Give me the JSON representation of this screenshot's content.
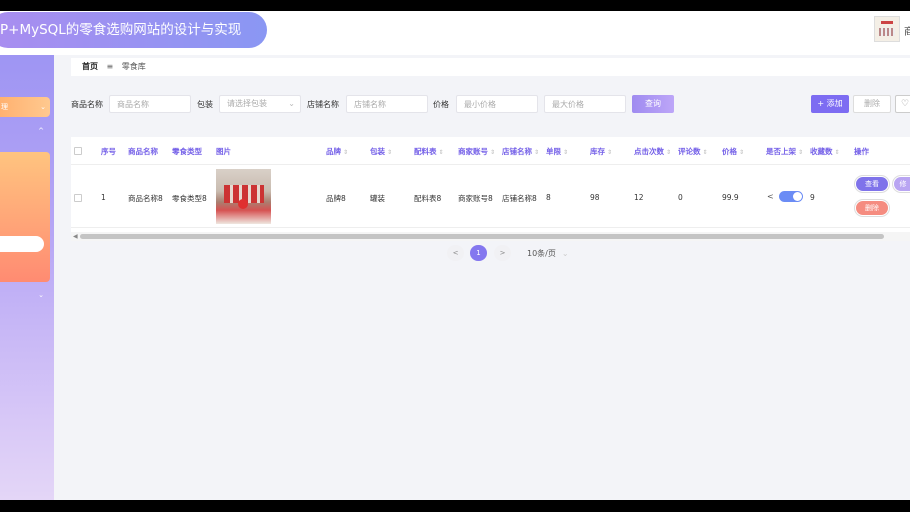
{
  "header": {
    "title": "P+MySQL的零食选购网站的设计与实现",
    "user_name": "商"
  },
  "sidebar": {
    "item1_label": "理",
    "item1_chevron": "⌄",
    "item2_chevron": "^",
    "item3_chevron": "⌄"
  },
  "breadcrumb": {
    "home": "首页",
    "separator": "≡",
    "current": "零食库"
  },
  "filters": {
    "name_label": "商品名称",
    "name_placeholder": "商品名称",
    "package_label": "包装",
    "package_placeholder": "请选择包装",
    "shop_label": "店铺名称",
    "shop_placeholder": "店铺名称",
    "price_label": "价格",
    "min_price_placeholder": "最小价格",
    "max_price_placeholder": "最大价格",
    "query_button": "查询",
    "add_button": "+ 添加",
    "delete_button": "删除",
    "extra_button": "♡"
  },
  "table": {
    "columns": [
      "序号",
      "商品名称",
      "零食类型",
      "图片",
      "品牌",
      "包装",
      "配料表",
      "商家账号",
      "店铺名称",
      "单限",
      "库存",
      "点击次数",
      "评论数",
      "价格",
      "是否上架",
      "收藏数",
      "操作"
    ],
    "rows": [
      {
        "index": "1",
        "name": "商品名称8",
        "type": "零食类型8",
        "brand": "品牌8",
        "package": "罐装",
        "ingredients": "配料表8",
        "merchant": "商家账号8",
        "shop": "店铺名称8",
        "limit": "8",
        "stock": "98",
        "clicks": "12",
        "comments": "0",
        "price": "99.9",
        "on_shelf": true,
        "favorites": "9",
        "actions": {
          "view": "查看",
          "edit": "修",
          "delete": "删除"
        }
      }
    ]
  },
  "pagination": {
    "prev": "<",
    "current_page": "1",
    "next": ">",
    "page_size": "10条/页"
  },
  "colors": {
    "accent": "#7d6cf2",
    "danger": "#f58c80",
    "sidebar_orange": "#ffb170"
  }
}
